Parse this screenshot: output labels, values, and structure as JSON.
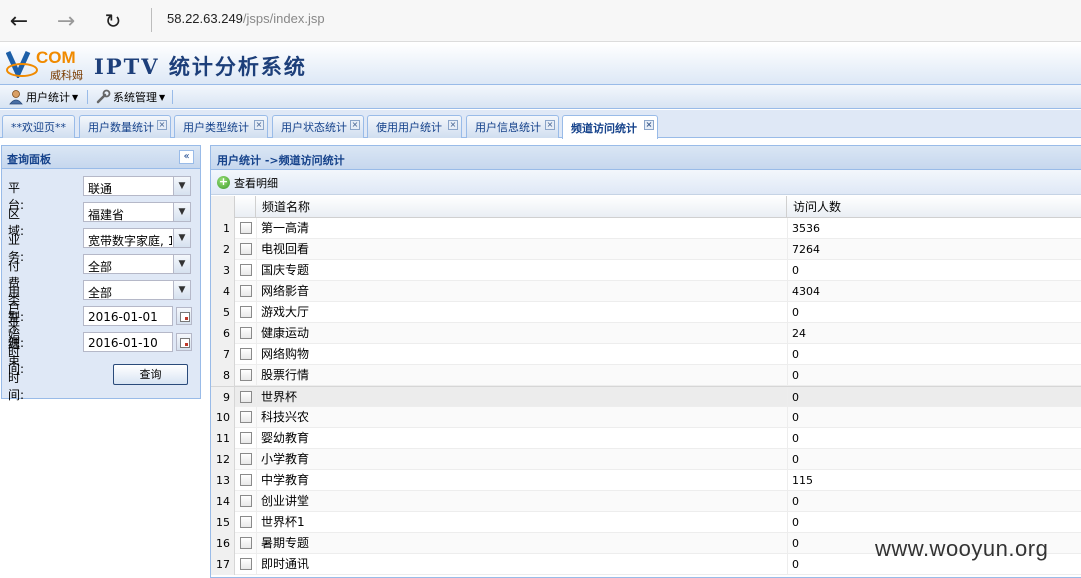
{
  "browser": {
    "url_host": "58.22.63.249",
    "url_path": "/jsps/index.jsp"
  },
  "app": {
    "logo_text": "COM",
    "logo_cn": "威科姆",
    "title": "IPTV 统计分析系统"
  },
  "menu": [
    {
      "label": "用户统计",
      "icon": "user-icon"
    },
    {
      "label": "系统管理",
      "icon": "wrench-icon"
    }
  ],
  "tabs": [
    {
      "label": "**欢迎页**",
      "closable": false,
      "active": false
    },
    {
      "label": "用户数量统计",
      "closable": true,
      "active": false
    },
    {
      "label": "用户类型统计",
      "closable": true,
      "active": false
    },
    {
      "label": "用户状态统计",
      "closable": true,
      "active": false
    },
    {
      "label": "使用用户统计",
      "closable": true,
      "active": false
    },
    {
      "label": "用户信息统计",
      "closable": true,
      "active": false
    },
    {
      "label": "频道访问统计",
      "closable": true,
      "active": true
    }
  ],
  "query_panel": {
    "title": "查询面板",
    "fields": [
      {
        "label": "平台:",
        "value": "联通",
        "type": "combo"
      },
      {
        "label": "区域:",
        "value": "福建省",
        "type": "combo"
      },
      {
        "label": "业务:",
        "value": "宽带数字家庭, 1",
        "type": "combo"
      },
      {
        "label": "付费类型:",
        "value": "全部",
        "type": "combo"
      },
      {
        "label": "用户来源:",
        "value": "全部",
        "type": "combo"
      },
      {
        "label": "开始时间:",
        "value": "2016-01-01",
        "type": "date"
      },
      {
        "label": "结束时间:",
        "value": "2016-01-10",
        "type": "date"
      }
    ],
    "query_button": "查询"
  },
  "main_panel": {
    "title": "用户统计 ->频道访问统计",
    "toolbar_button": "查看明细",
    "columns": [
      "频道名称",
      "访问人数"
    ],
    "rows": [
      {
        "num": "1",
        "name": "第一高清",
        "count": "3536"
      },
      {
        "num": "2",
        "name": "电视回看",
        "count": "7264"
      },
      {
        "num": "3",
        "name": "国庆专题",
        "count": "0"
      },
      {
        "num": "4",
        "name": "网络影音",
        "count": "4304"
      },
      {
        "num": "5",
        "name": "游戏大厅",
        "count": "0"
      },
      {
        "num": "6",
        "name": "健康运动",
        "count": "24"
      },
      {
        "num": "7",
        "name": "网络购物",
        "count": "0"
      },
      {
        "num": "8",
        "name": "股票行情",
        "count": "0"
      },
      {
        "num": "9",
        "name": "世界杯",
        "count": "0"
      },
      {
        "num": "10",
        "name": "科技兴农",
        "count": "0"
      },
      {
        "num": "11",
        "name": "婴幼教育",
        "count": "0"
      },
      {
        "num": "12",
        "name": "小学教育",
        "count": "0"
      },
      {
        "num": "13",
        "name": "中学教育",
        "count": "115"
      },
      {
        "num": "14",
        "name": "创业讲堂",
        "count": "0"
      },
      {
        "num": "15",
        "name": "世界杯1",
        "count": "0"
      },
      {
        "num": "16",
        "name": "暑期专题",
        "count": "0"
      },
      {
        "num": "17",
        "name": "即时通讯",
        "count": "0"
      }
    ]
  },
  "watermark": "www.wooyun.org"
}
